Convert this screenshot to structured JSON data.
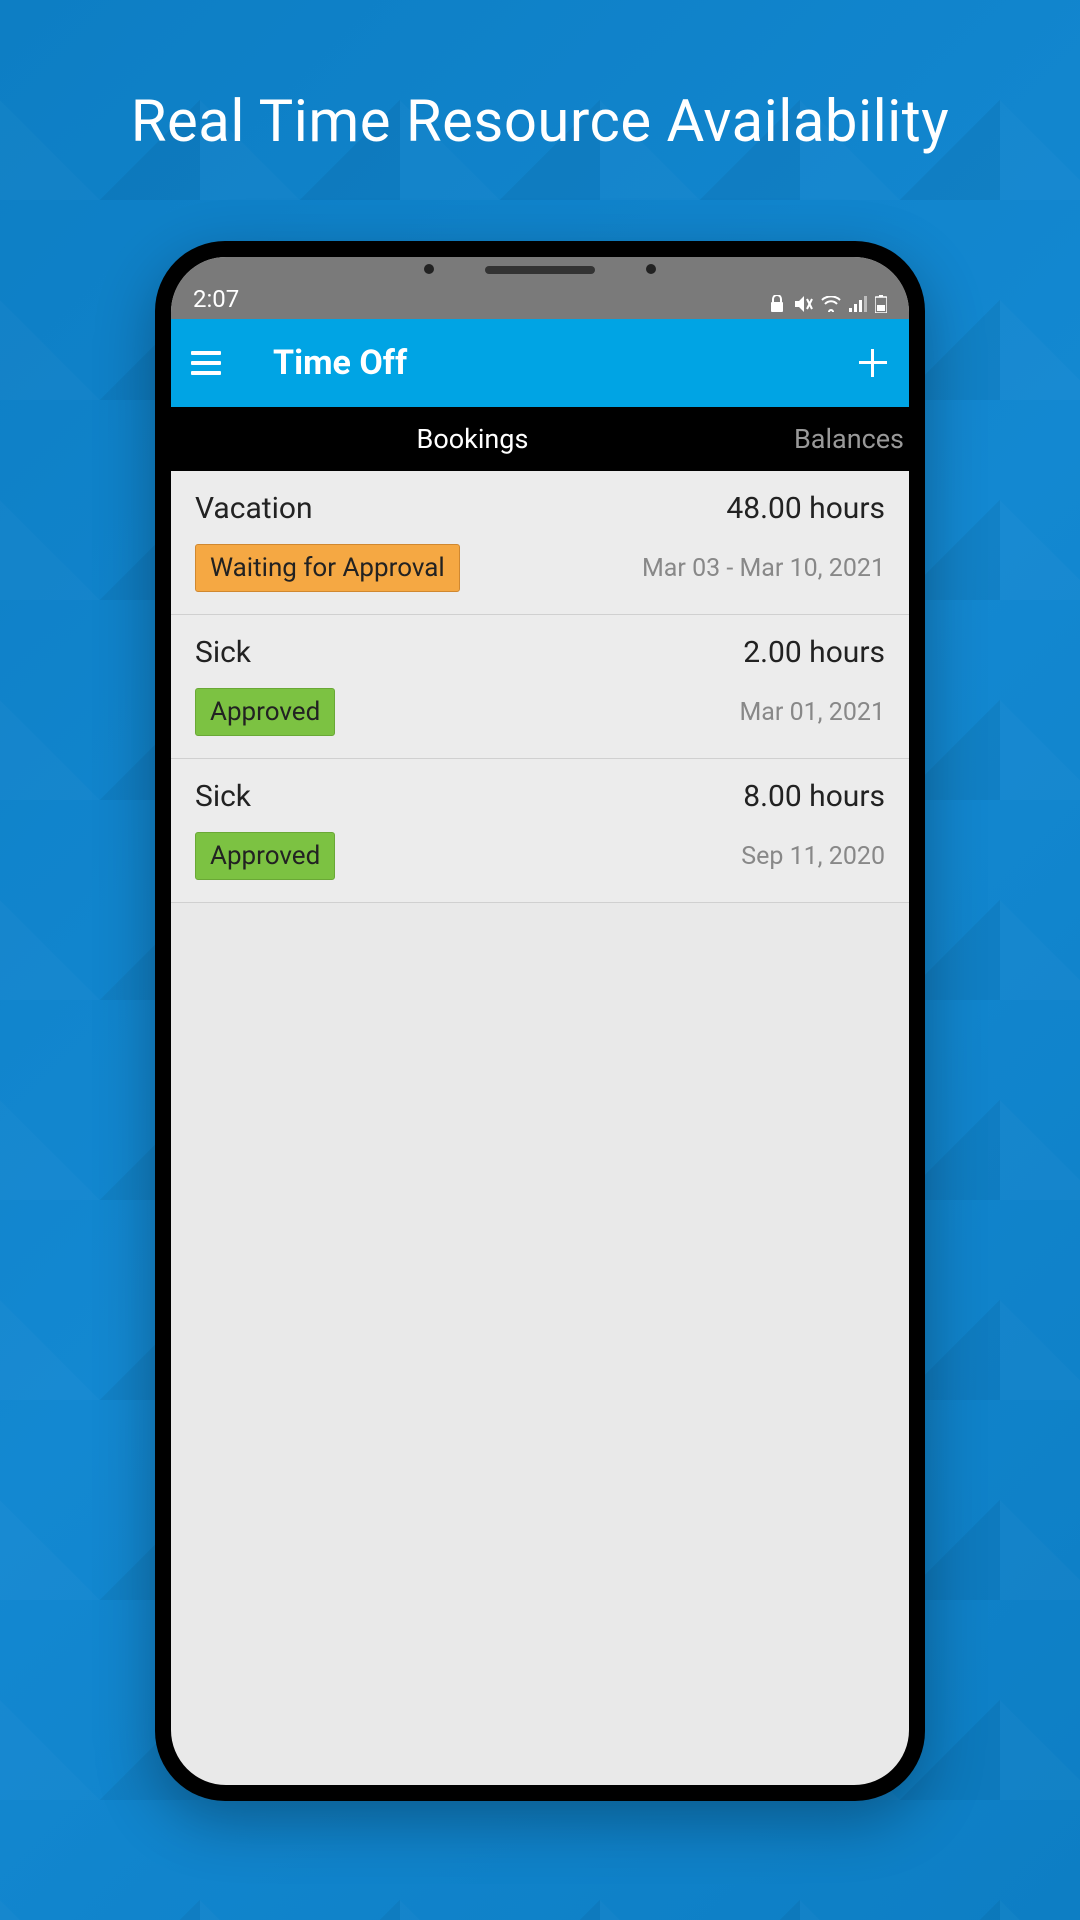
{
  "page": {
    "title": "Real Time Resource Availability"
  },
  "status_bar": {
    "time": "2:07"
  },
  "header": {
    "title": "Time Off"
  },
  "tabs": {
    "bookings": "Bookings",
    "balances": "Balances"
  },
  "bookings": [
    {
      "type": "Vacation",
      "hours": "48.00 hours",
      "status": "Waiting for Approval",
      "status_kind": "waiting",
      "date": "Mar 03 - Mar 10, 2021"
    },
    {
      "type": "Sick",
      "hours": "2.00 hours",
      "status": "Approved",
      "status_kind": "approved",
      "date": "Mar 01, 2021"
    },
    {
      "type": "Sick",
      "hours": "8.00 hours",
      "status": "Approved",
      "status_kind": "approved",
      "date": "Sep 11, 2020"
    }
  ]
}
